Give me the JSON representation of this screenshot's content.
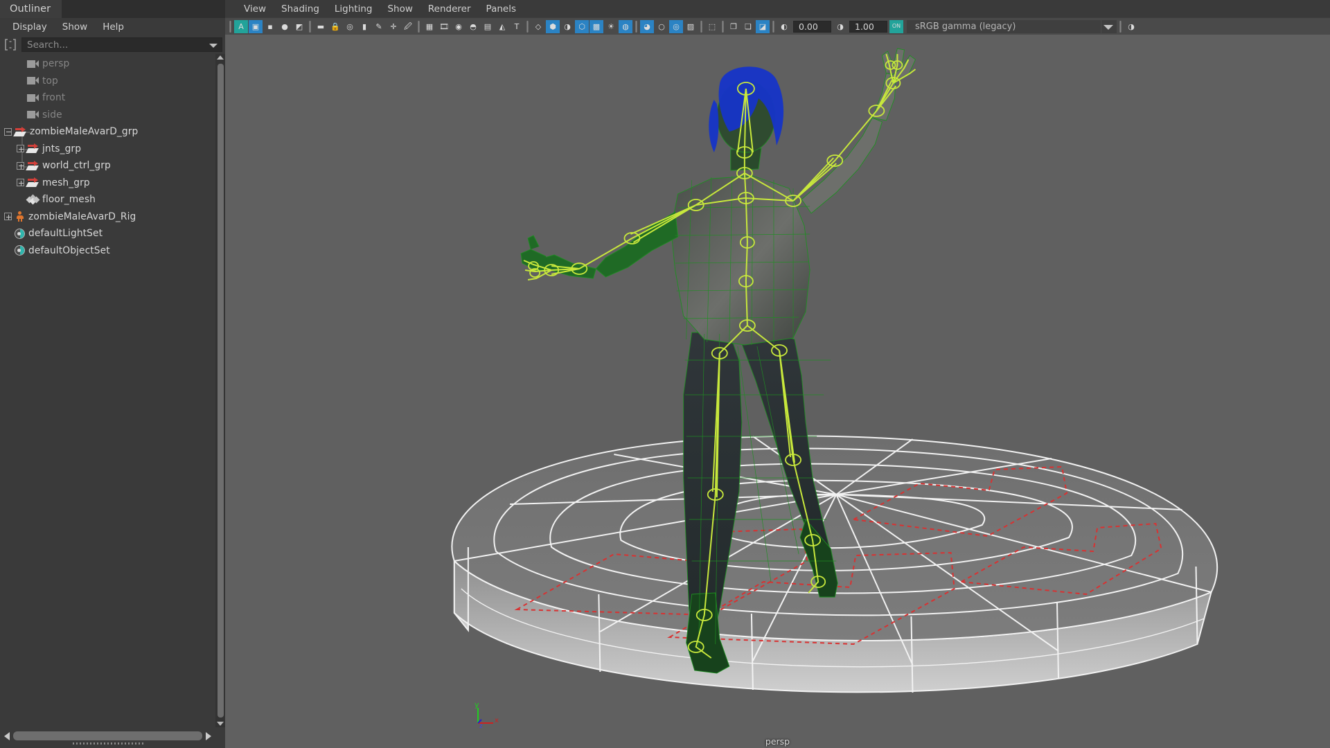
{
  "outliner": {
    "tab_label": "Outliner",
    "menus": [
      "Display",
      "Show",
      "Help"
    ],
    "filter_icon": "filter-bracket-icon",
    "search": {
      "placeholder": "Search...",
      "value": ""
    },
    "tree": [
      {
        "label": "persp",
        "icon": "camera-icon",
        "depth": 1,
        "expander": "none",
        "dim": true
      },
      {
        "label": "top",
        "icon": "camera-icon",
        "depth": 1,
        "expander": "none",
        "dim": true
      },
      {
        "label": "front",
        "icon": "camera-icon",
        "depth": 1,
        "expander": "none",
        "dim": true
      },
      {
        "label": "side",
        "icon": "camera-icon",
        "depth": 1,
        "expander": "none",
        "dim": true
      },
      {
        "label": "zombieMaleAvarD_grp",
        "icon": "transform-icon",
        "depth": 0,
        "expander": "collapse",
        "dim": false
      },
      {
        "label": "jnts_grp",
        "icon": "transform-icon",
        "depth": 1,
        "expander": "expand",
        "dim": false
      },
      {
        "label": "world_ctrl_grp",
        "icon": "transform-icon",
        "depth": 1,
        "expander": "expand",
        "dim": false
      },
      {
        "label": "mesh_grp",
        "icon": "transform-icon",
        "depth": 1,
        "expander": "expand",
        "dim": false
      },
      {
        "label": "floor_mesh",
        "icon": "mesh-icon",
        "depth": 1,
        "expander": "none",
        "dim": false
      },
      {
        "label": "zombieMaleAvarD_Rig",
        "icon": "character-icon",
        "depth": 0,
        "expander": "expand",
        "dim": false
      },
      {
        "label": "defaultLightSet",
        "icon": "set-icon",
        "depth": 0,
        "expander": "none",
        "dim": false
      },
      {
        "label": "defaultObjectSet",
        "icon": "set-icon",
        "depth": 0,
        "expander": "none",
        "dim": false
      }
    ],
    "scrollbars": {
      "vertical": "outliner-vertical-scrollbar",
      "horizontal": "outliner-horizontal-scrollbar"
    }
  },
  "viewport": {
    "menus": [
      "View",
      "Shading",
      "Lighting",
      "Show",
      "Renderer",
      "Panels"
    ],
    "camera_label": "persp",
    "background_color": "#606060",
    "toolbar": {
      "exposure_value": "0.00",
      "gamma_value": "1.00",
      "view_transform": "sRGB gamma (legacy)",
      "color_management_toggle": "ON",
      "items": [
        {
          "name": "separator",
          "kind": "sep"
        },
        {
          "name": "select-camera-icon",
          "kind": "btn",
          "glyph": "A",
          "state": "on-teal"
        },
        {
          "name": "resolution-gate-icon",
          "kind": "btn",
          "glyph": "▣",
          "state": "active"
        },
        {
          "name": "film-gate-icon",
          "kind": "btn",
          "glyph": "▪",
          "state": "off"
        },
        {
          "name": "field-chart-icon",
          "kind": "btn",
          "glyph": "●",
          "state": "off"
        },
        {
          "name": "safe-action-icon",
          "kind": "btn",
          "glyph": "◩",
          "state": "off"
        },
        {
          "name": "separator",
          "kind": "sep"
        },
        {
          "name": "camera-attributes-icon",
          "kind": "btn",
          "glyph": "▬",
          "state": "off"
        },
        {
          "name": "lock-camera-icon",
          "kind": "btn",
          "glyph": "🔒",
          "state": "off"
        },
        {
          "name": "camera-bookmark-icon",
          "kind": "btn",
          "glyph": "◎",
          "state": "off"
        },
        {
          "name": "bookmark-icon",
          "kind": "btn",
          "glyph": "▮",
          "state": "off"
        },
        {
          "name": "grease-pencil-icon",
          "kind": "btn",
          "glyph": "✎",
          "state": "off"
        },
        {
          "name": "move-tool-icon",
          "kind": "btn",
          "glyph": "✛",
          "state": "off"
        },
        {
          "name": "paint-tool-icon",
          "kind": "btn",
          "glyph": "🖉",
          "state": "off"
        },
        {
          "name": "separator",
          "kind": "sep"
        },
        {
          "name": "grid-toggle-icon",
          "kind": "btn",
          "glyph": "▦",
          "state": "off"
        },
        {
          "name": "film-back-icon",
          "kind": "btn",
          "glyph": "🎞",
          "state": "off"
        },
        {
          "name": "image-plane-icon",
          "kind": "btn",
          "glyph": "◉",
          "state": "off"
        },
        {
          "name": "shadows-icon",
          "kind": "btn",
          "glyph": "◓",
          "state": "off"
        },
        {
          "name": "hud-icon",
          "kind": "btn",
          "glyph": "▤",
          "state": "off"
        },
        {
          "name": "texture-icon",
          "kind": "btn",
          "glyph": "◭",
          "state": "off"
        },
        {
          "name": "text-overlay-icon",
          "kind": "btn",
          "glyph": "T",
          "state": "off"
        },
        {
          "name": "separator",
          "kind": "sep"
        },
        {
          "name": "wireframe-shading-icon",
          "kind": "btn",
          "glyph": "◇",
          "state": "off"
        },
        {
          "name": "smooth-shade-all-icon",
          "kind": "btn",
          "glyph": "⬢",
          "state": "active"
        },
        {
          "name": "flat-shade-icon",
          "kind": "btn",
          "glyph": "◑",
          "state": "off"
        },
        {
          "name": "wireframe-on-shaded-icon",
          "kind": "btn",
          "glyph": "⬡",
          "state": "active"
        },
        {
          "name": "texture-display-icon",
          "kind": "btn",
          "glyph": "▩",
          "state": "active"
        },
        {
          "name": "use-default-lighting-icon",
          "kind": "btn",
          "glyph": "☀",
          "state": "off"
        },
        {
          "name": "all-lights-icon",
          "kind": "btn",
          "glyph": "◍",
          "state": "active"
        },
        {
          "name": "separator",
          "kind": "sep"
        },
        {
          "name": "shadows-toggle-icon",
          "kind": "btn",
          "glyph": "◕",
          "state": "active"
        },
        {
          "name": "ambient-occlusion-icon",
          "kind": "btn",
          "glyph": "○",
          "state": "off"
        },
        {
          "name": "motion-blur-icon",
          "kind": "btn",
          "glyph": "◎",
          "state": "active"
        },
        {
          "name": "multisample-icon",
          "kind": "btn",
          "glyph": "▨",
          "state": "off"
        },
        {
          "name": "separator",
          "kind": "sep"
        },
        {
          "name": "isolate-select-icon",
          "kind": "btn",
          "glyph": "⬚",
          "state": "off"
        },
        {
          "name": "separator",
          "kind": "sep"
        },
        {
          "name": "xray-icon",
          "kind": "btn",
          "glyph": "❐",
          "state": "off"
        },
        {
          "name": "xray-joints-icon",
          "kind": "btn",
          "glyph": "❏",
          "state": "off"
        },
        {
          "name": "xray-active-components-icon",
          "kind": "btn",
          "glyph": "◪",
          "state": "active"
        },
        {
          "name": "separator",
          "kind": "sep"
        },
        {
          "name": "exposure-icon",
          "kind": "btn",
          "glyph": "◑",
          "state": "off"
        }
      ]
    },
    "axis_gizmo": {
      "x_label": "x",
      "y_label": "y",
      "z_label": "z",
      "x_color": "#cc2222",
      "y_color": "#22cc22",
      "z_color": "#2222cc"
    },
    "scene": {
      "character_name": "zombieMaleAvarD",
      "selection_wireframe_color": "#1f8f22",
      "hair_color": "#1634c8",
      "joint_color": "#c8e83c",
      "floor_wire_color": "#f2f2f2",
      "control_curve_color": "#d83232"
    }
  }
}
